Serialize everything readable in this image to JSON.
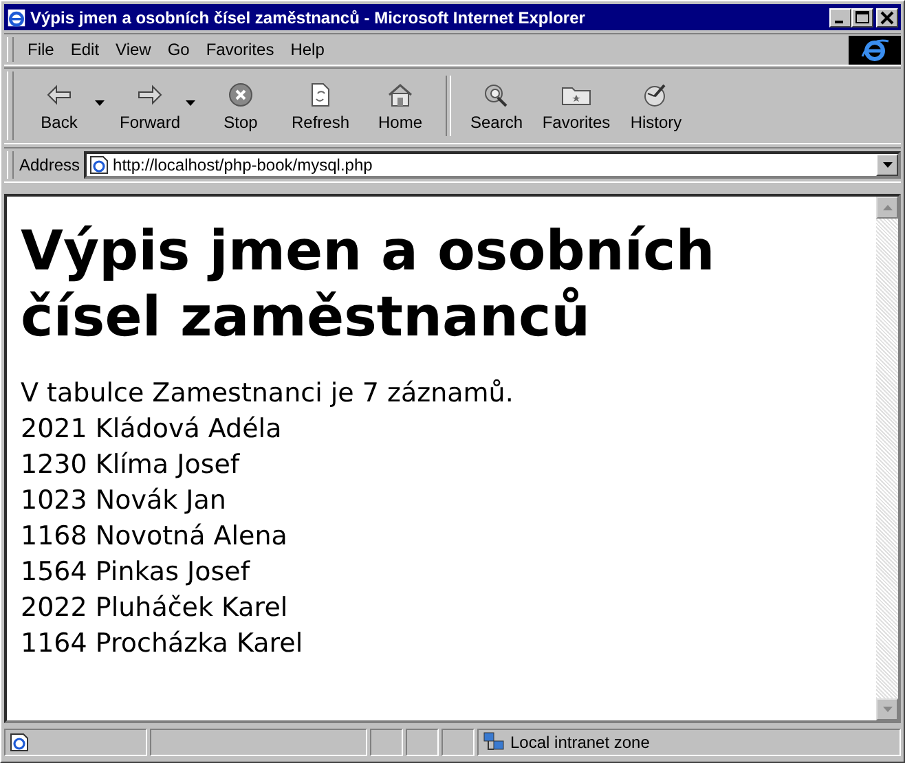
{
  "window": {
    "title": "Výpis jmen a osobních čísel zaměstnanců - Microsoft Internet Explorer"
  },
  "menu": [
    "File",
    "Edit",
    "View",
    "Go",
    "Favorites",
    "Help"
  ],
  "toolbar": [
    {
      "label": "Back",
      "kind": "back",
      "dropdown": true
    },
    {
      "label": "Forward",
      "kind": "forward",
      "dropdown": true
    },
    {
      "label": "Stop",
      "kind": "stop",
      "dropdown": false
    },
    {
      "label": "Refresh",
      "kind": "refresh",
      "dropdown": false
    },
    {
      "label": "Home",
      "kind": "home",
      "dropdown": false
    },
    {
      "label": "Search",
      "kind": "search",
      "dropdown": false
    },
    {
      "label": "Favorites",
      "kind": "favorites",
      "dropdown": false
    },
    {
      "label": "History",
      "kind": "history",
      "dropdown": false
    }
  ],
  "address": {
    "label": "Address",
    "value": "http://localhost/php-book/mysql.php"
  },
  "page": {
    "heading": "Výpis jmen a osobních čísel zaměstnanců",
    "summary": "V tabulce Zamestnanci je 7 záznamů.",
    "lines": [
      "2021 Kládová Adéla",
      "1230 Klíma Josef",
      "1023 Novák Jan",
      "1168 Novotná Alena",
      "1564 Pinkas Josef",
      "2022 Pluháček Karel",
      "1164 Procházka Karel"
    ]
  },
  "status_bar": {
    "zone": "Local intranet zone"
  }
}
